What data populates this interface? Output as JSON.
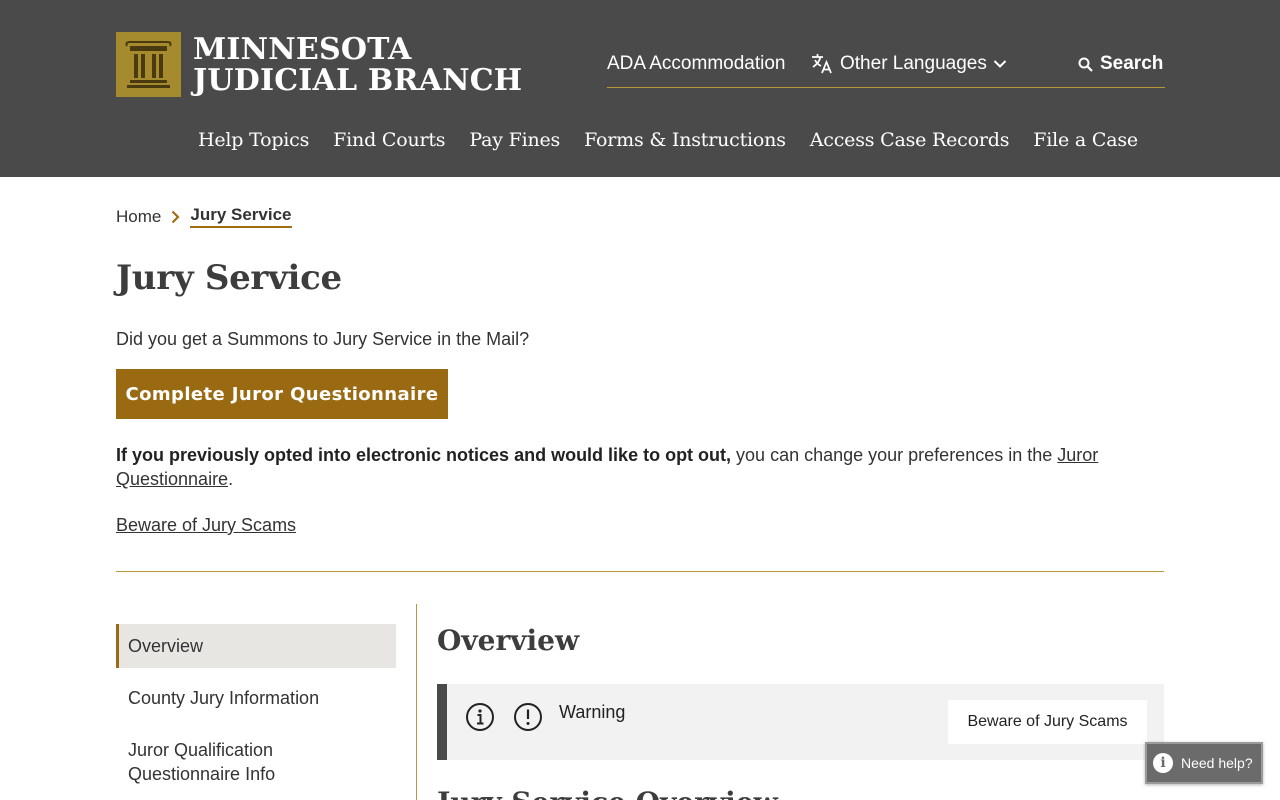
{
  "brand": {
    "line1": "MINNESOTA",
    "line2": "JUDICIAL BRANCH",
    "logo_icon": "courthouse-columns-icon",
    "accent_color": "#9a6a13",
    "header_bg": "#4a4a4a"
  },
  "utility_nav": {
    "ada": "ADA Accommodation",
    "languages": "Other Languages",
    "search": "Search"
  },
  "main_nav": [
    "Help Topics",
    "Find Courts",
    "Pay Fines",
    "Forms & Instructions",
    "Access Case Records",
    "File a Case"
  ],
  "breadcrumb": {
    "home": "Home",
    "current": "Jury Service"
  },
  "page": {
    "title": "Jury Service",
    "intro": "Did you get a Summons to Jury Service in the Mail?",
    "cta": "Complete Juror Questionnaire",
    "optout_bold": "If you previously opted into electronic notices and would like to opt out,",
    "optout_text": " you can change your preferences in the ",
    "optout_link": "Juror Questionnaire",
    "optout_end": ".",
    "scam_link": "Beware of Jury Scams"
  },
  "sidenav": [
    "Overview",
    "County Jury Information",
    "Juror Qualification Questionnaire Info"
  ],
  "content": {
    "section_title": "Overview",
    "warning_label": "Warning",
    "warning_button": "Beware of Jury Scams",
    "next_title": "Jury Service Overview"
  },
  "help": {
    "label": "Need help?"
  }
}
